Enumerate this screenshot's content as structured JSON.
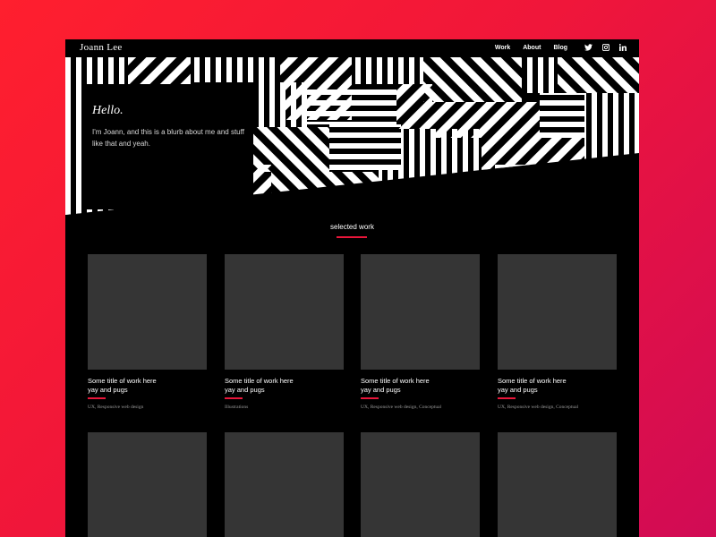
{
  "brand": {
    "name": "Joann Lee"
  },
  "nav": {
    "links": [
      {
        "label": "Work"
      },
      {
        "label": "About"
      },
      {
        "label": "Blog"
      }
    ],
    "socials": [
      "twitter-icon",
      "instagram-icon",
      "linkedin-icon"
    ]
  },
  "hero": {
    "greeting": "Hello.",
    "blurb": "I'm Joann, and this is a blurb about me and stuff like that and yeah."
  },
  "section": {
    "title": "selected work"
  },
  "works": [
    {
      "title_line1": "Some title of work here",
      "title_line2": "yay and pugs",
      "tags": "UX, Responsive web design"
    },
    {
      "title_line1": "Some title of work here",
      "title_line2": "yay and pugs",
      "tags": "Illustrations"
    },
    {
      "title_line1": "Some title of work here",
      "title_line2": "yay and pugs",
      "tags": "UX, Responsive web design, Conceptual"
    },
    {
      "title_line1": "Some title of work here",
      "title_line2": "yay and pugs",
      "tags": "UX, Responsive web design, Conceptual"
    }
  ],
  "colors": {
    "accent": "#e8163a",
    "frame": "#000000",
    "thumb": "#353535",
    "gradient_start": "#ff1f2e",
    "gradient_end": "#d10b55"
  }
}
